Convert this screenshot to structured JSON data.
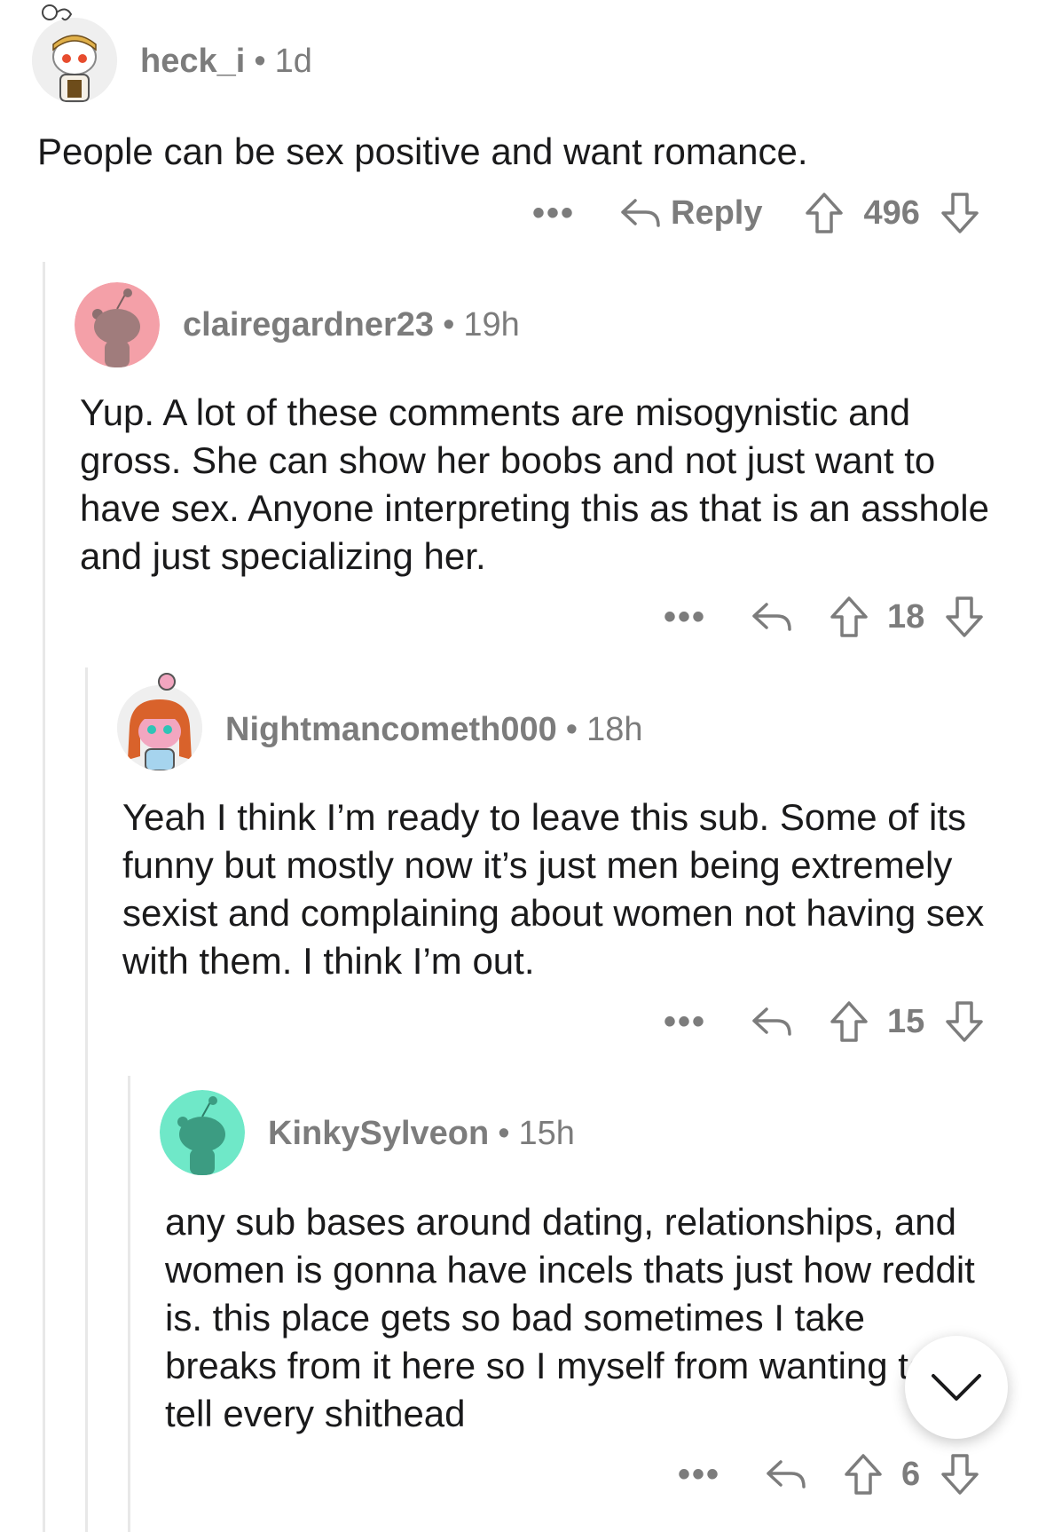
{
  "comments": [
    {
      "username": "heck_i",
      "time": "1d",
      "text": "People can be sex positive and want romance.",
      "reply_label": "Reply",
      "score": "496",
      "more_label": "•••"
    },
    {
      "username": "clairegardner23",
      "time": "19h",
      "text": "Yup. A lot of these comments are misogynistic and gross. She can show her boobs and not just want to have sex. Anyone interpreting this as that is an asshole and just specializing her.",
      "score": "18",
      "more_label": "•••"
    },
    {
      "username": "Nightmancometh000",
      "time": "18h",
      "text": "Yeah I think I’m ready to leave this sub. Some of its funny but mostly now it’s just men being extremely sexist and complaining about women not having sex with them. I think I’m out.",
      "score": "15",
      "more_label": "•••"
    },
    {
      "username": "KinkySylveon",
      "time": "15h",
      "text": "any sub bases around dating, relationships, and women is gonna have incels thats just how reddit is. this place gets so bad sometimes I take breaks from it here so I myself from wanting to tell every shithead",
      "score": "6",
      "more_label": "•••"
    }
  ],
  "separator": "•",
  "colors": {
    "avatar_pink": "#f4a0a8",
    "avatar_teal": "#6fe8c8",
    "meta_gray": "#7c7c7c",
    "thread_line": "#e8e8e8"
  },
  "icons": {
    "reply": "reply-arrow-icon",
    "upvote": "upvote-arrow-icon",
    "downvote": "downvote-arrow-icon",
    "collapse": "chevron-down-icon"
  }
}
